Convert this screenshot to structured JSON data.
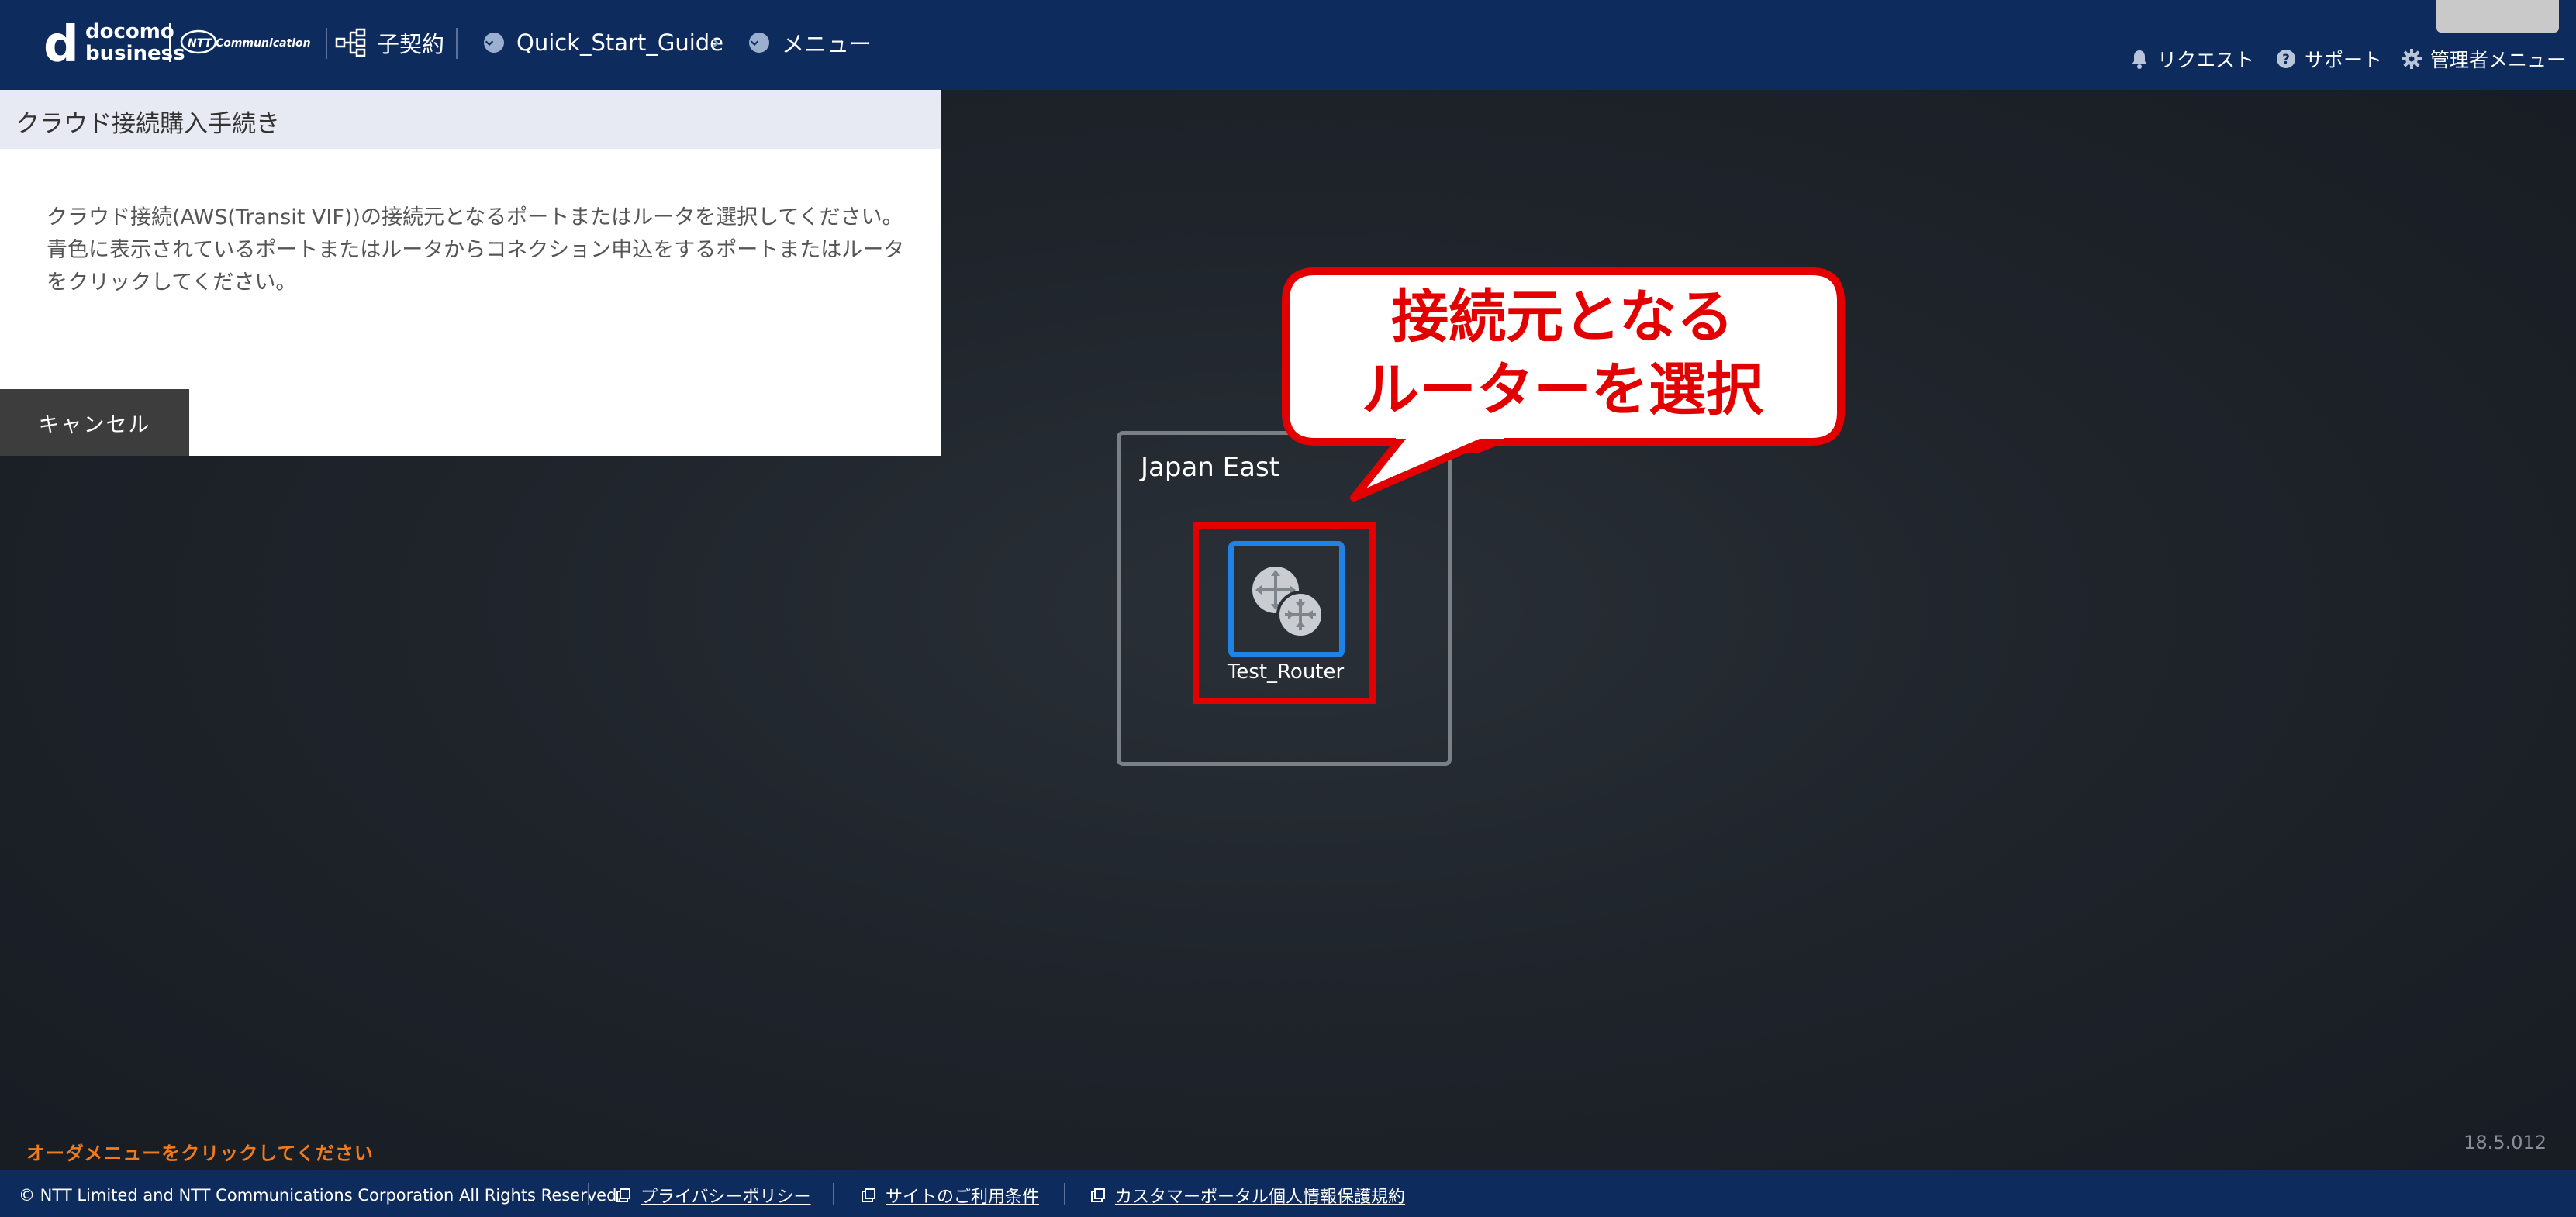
{
  "header": {
    "logo_docomo_mark": "d",
    "logo_docomo_line1": "docomo",
    "logo_docomo_line2": "business",
    "logo_ntt": "NTT Communications",
    "nav_contract": "子契約",
    "nav_guide": "Quick_Start_Guide",
    "nav_menu": "メニュー",
    "right_request": "リクエスト",
    "right_support": "サポート",
    "right_admin": "管理者メニュー"
  },
  "panel": {
    "title": "クラウド接続購入手続き",
    "body_line1": "クラウド接続(AWS(Transit VIF))の接続元となるポートまたはルータを選択してください。",
    "body_line2": "青色に表示されているポートまたはルータからコネクション申込をするポートまたはルータをクリックしてください。",
    "cancel_label": "キャンセル"
  },
  "canvas": {
    "region_name": "Japan East",
    "router_name": "Test_Router",
    "router_icon": "router-icon",
    "selectable_color": "#1e82e6"
  },
  "callout": {
    "line1": "接続元となる",
    "line2": "ルーターを選択",
    "color": "#e20000"
  },
  "bottom": {
    "order_hint": "オーダメニューをクリックしてください",
    "version": "18.5.012"
  },
  "footer": {
    "copyright": "© NTT Limited and NTT Communications Corporation All Rights Reserved.",
    "link_privacy": "プライバシーポリシー",
    "link_terms": "サイトのご利用条件",
    "link_portal_privacy": "カスタマーポータル個人情報保護規約"
  }
}
